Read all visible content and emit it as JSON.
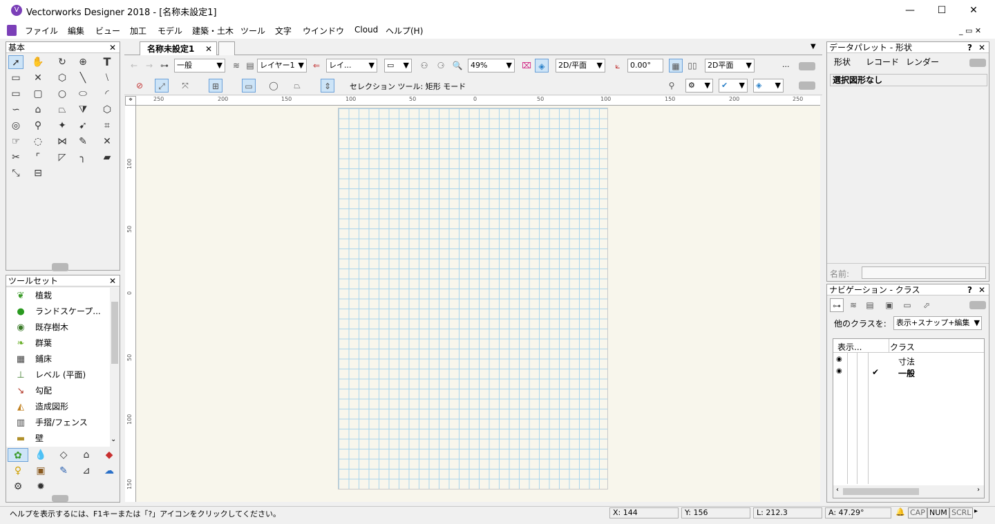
{
  "window": {
    "title": "Vectorworks Designer 2018 - [名称未設定1]",
    "app_icon": "V",
    "min": "—",
    "max": "☐",
    "close": "✕"
  },
  "menu": [
    "ファイル",
    "編集",
    "ビュー",
    "加工",
    "モデル",
    "建築・土木",
    "ツール",
    "文字",
    "ウインドウ",
    "Cloud",
    "ヘルプ(H)"
  ],
  "basic_palette": {
    "title": "基本",
    "close": "✕"
  },
  "toolsets": {
    "title": "ツールセット",
    "close": "✕",
    "items": [
      {
        "label": "植栽",
        "icon": "plant-icon"
      },
      {
        "label": "ランドスケープ...",
        "icon": "landscape-icon"
      },
      {
        "label": "既存樹木",
        "icon": "existing-tree-icon"
      },
      {
        "label": "群葉",
        "icon": "foliage-icon"
      },
      {
        "label": "鋪床",
        "icon": "paving-icon"
      },
      {
        "label": "レベル (平面)",
        "icon": "level-icon"
      },
      {
        "label": "勾配",
        "icon": "slope-icon"
      },
      {
        "label": "造成図形",
        "icon": "grading-icon"
      },
      {
        "label": "手摺/フェンス",
        "icon": "fence-icon"
      },
      {
        "label": "壁",
        "icon": "wall-icon"
      }
    ]
  },
  "doc_tab": {
    "label": "名称未設定1",
    "close": "✕"
  },
  "view_bar": {
    "class": "一般",
    "layer": "レイヤー1",
    "layer2": "レイ...",
    "zoom": "49%",
    "view": "2D/平面",
    "angle": "0.00°",
    "render": "2D平面",
    "more": "..."
  },
  "tool_bar": {
    "mode_text": "セレクション ツール: 矩形 モード"
  },
  "ruler_h": [
    "250",
    "200",
    "150",
    "100",
    "50",
    "0",
    "50",
    "100",
    "150",
    "200",
    "250"
  ],
  "ruler_v": [
    "100",
    "50",
    "0",
    "50",
    "100",
    "150"
  ],
  "data_palette": {
    "title": "データパレット - 形状",
    "help": "?",
    "close": "✕",
    "tabs": [
      "形状",
      "レコード",
      "レンダー"
    ],
    "selection": "選択図形なし",
    "name_label": "名前:"
  },
  "nav_palette": {
    "title": "ナビゲーション - クラス",
    "help": "?",
    "close": "✕",
    "other_label": "他のクラスを:",
    "other_value": "表示+スナップ+編集",
    "col_show": "表示...",
    "col_class": "クラス",
    "rows": [
      {
        "class": "寸法",
        "checked": "",
        "bold": false
      },
      {
        "class": "一般",
        "checked": "✔",
        "bold": true
      }
    ]
  },
  "status": {
    "hint": "ヘルプを表示するには、F1キーまたは「?」アイコンをクリックしてください。",
    "x": "X: 144",
    "y": "Y: 156",
    "l": "L: 212.3",
    "a": "A: 47.29°",
    "cap": "CAP",
    "num": "NUM",
    "scrl": "SCRL"
  }
}
